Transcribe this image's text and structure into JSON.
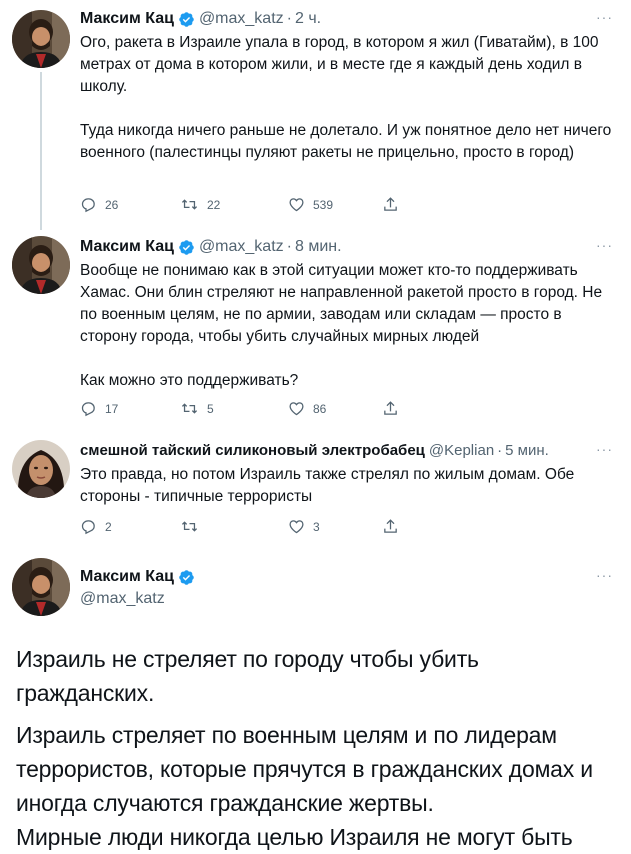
{
  "tweets": [
    {
      "author_name": "Максим Кац",
      "handle": "@max_katz",
      "time": "2 ч.",
      "paragraphs": [
        "Ого, ракета в Израиле упала в город, в котором я жил (Гиватайм), в 100 метрах от дома в котором жили, и в месте где я каждый день ходил в школу.",
        "Туда никогда ничего раньше не долетало. И уж понятное дело нет ничего военного (палестинцы пуляют ракеты не прицельно, просто в город)"
      ],
      "replies": "26",
      "retweets": "22",
      "likes": "539"
    },
    {
      "author_name": "Максим Кац",
      "handle": "@max_katz",
      "time": "8 мин.",
      "paragraphs": [
        "Вообще не понимаю как в этой ситуации может кто-то поддерживать Хамас. Они блин стреляют не направленной ракетой просто в город. Не по военным целям, не по армии, заводам или складам — просто в сторону города, чтобы убить случайных мирных людей",
        "Как можно это поддерживать?"
      ],
      "replies": "17",
      "retweets": "5",
      "likes": "86"
    },
    {
      "author_name": "смешной тайский силиконовый электробабец",
      "handle": "@Keplian",
      "time": "5 мин.",
      "paragraphs": [
        "Это правда, но потом Израиль также стрелял по жилым домам. Обе стороны - типичные террористы"
      ],
      "replies": "2",
      "retweets": "",
      "likes": "3"
    }
  ],
  "main_tweet": {
    "author_name": "Максим Кац",
    "handle": "@max_katz",
    "paragraphs": [
      "Израиль не стреляет по городу чтобы убить гражданских.",
      "Израиль стреляет по военным целям и по лидерам террористов, которые прячутся в гражданских домах и иногда случаются гражданские жертвы.",
      "Мирные люди никогда целью Израиля не могут быть"
    ]
  },
  "separator": "·",
  "menu_icon": "more-dots-icon",
  "colors": {
    "verified": "#1d9bf0",
    "secondary_text": "#536471",
    "thread_line": "#cfd9de"
  }
}
